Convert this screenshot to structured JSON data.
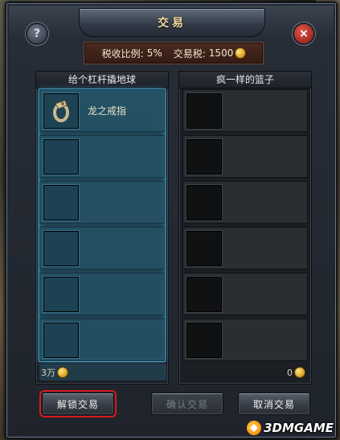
{
  "window": {
    "title": "交易",
    "help_label": "?",
    "close_label": "×"
  },
  "tax": {
    "rate_label": "税收比例:",
    "rate_value": "5%",
    "tax_label": "交易税:",
    "tax_value": "1500"
  },
  "left_panel": {
    "player_name": "给个杠杆撬地球",
    "items": [
      {
        "name": "龙之戒指",
        "icon": "ring-icon"
      },
      {
        "name": "",
        "icon": ""
      },
      {
        "name": "",
        "icon": ""
      },
      {
        "name": "",
        "icon": ""
      },
      {
        "name": "",
        "icon": ""
      },
      {
        "name": "",
        "icon": ""
      }
    ],
    "gold": "3万"
  },
  "right_panel": {
    "player_name": "疯一样的篮子",
    "items": [
      {
        "name": ""
      },
      {
        "name": ""
      },
      {
        "name": ""
      },
      {
        "name": ""
      },
      {
        "name": ""
      },
      {
        "name": ""
      }
    ],
    "gold": "0"
  },
  "buttons": {
    "unlock": "解锁交易",
    "confirm": "确认交易",
    "cancel": "取消交易"
  },
  "watermark": {
    "text": "3DMGAME"
  },
  "colors": {
    "title_gold": "#f2dca0",
    "highlight_blue": "#4b9fc5",
    "selection_red": "#d81a1a",
    "close_red": "#c8322a"
  }
}
